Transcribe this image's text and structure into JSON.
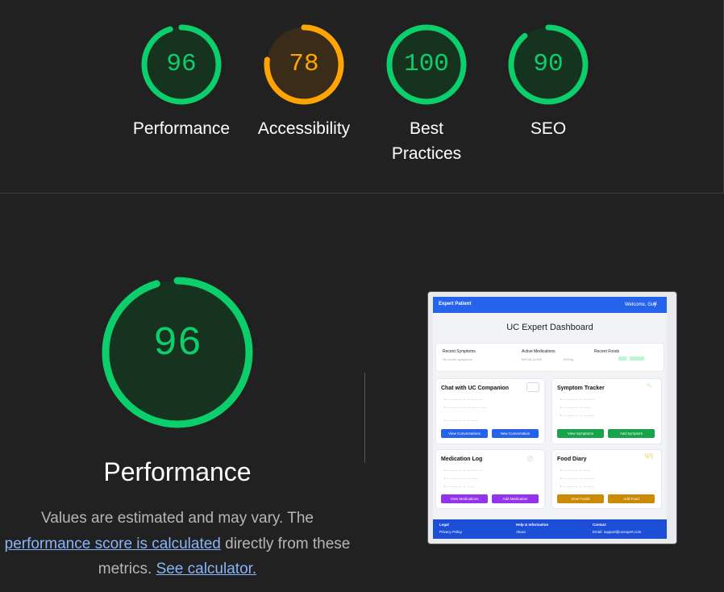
{
  "colors": {
    "pass": "#0cce6b",
    "average": "#ffa400"
  },
  "scores": [
    {
      "value": "96",
      "label": [
        "Performance"
      ],
      "color": "#0cce6b",
      "fraction": 0.96
    },
    {
      "value": "78",
      "label": [
        "Accessibility"
      ],
      "color": "#ffa400",
      "fraction": 0.78
    },
    {
      "value": "100",
      "label": [
        "Best",
        "Practices"
      ],
      "color": "#0cce6b",
      "fraction": 1.0
    },
    {
      "value": "90",
      "label": [
        "SEO"
      ],
      "color": "#0cce6b",
      "fraction": 0.9
    }
  ],
  "performance": {
    "score": "96",
    "title": "Performance",
    "desc_1": "Values are estimated and may vary. The",
    "link_1": "performance score is calculated",
    "desc_2": " directly from these metrics.",
    "link_2": "See calculator."
  },
  "screenshot": {
    "brand": "Expert Patient",
    "welcome": "Welcome, Guy",
    "dashboard_title": "UC Expert Dashboard",
    "summary": {
      "recent_symptoms": "Recent Symptoms",
      "no_symptoms": "No recent symptoms",
      "active_medications": "Active Medications",
      "medication_name": "MESALAZINE",
      "medication_dose": "500mg",
      "recent_foods": "Recent Foods"
    },
    "cards": {
      "chat": {
        "title": "Chat with UC Companion",
        "btn1": "View Conversations",
        "btn2": "New Conversation"
      },
      "symptom": {
        "title": "Symptom Tracker",
        "btn1": "View Symptoms",
        "btn2": "Add Symptom"
      },
      "medication": {
        "title": "Medication Log",
        "btn1": "View Medications",
        "btn2": "Add Medication"
      },
      "food": {
        "title": "Food Diary",
        "btn1": "View Foods",
        "btn2": "Add Food"
      }
    },
    "footer": {
      "legal": "Legal",
      "privacy": "Privacy Policy",
      "help": "Help & Information",
      "about": "About",
      "contact": "Contact",
      "email": "Email: support@ucexpert.com"
    }
  }
}
